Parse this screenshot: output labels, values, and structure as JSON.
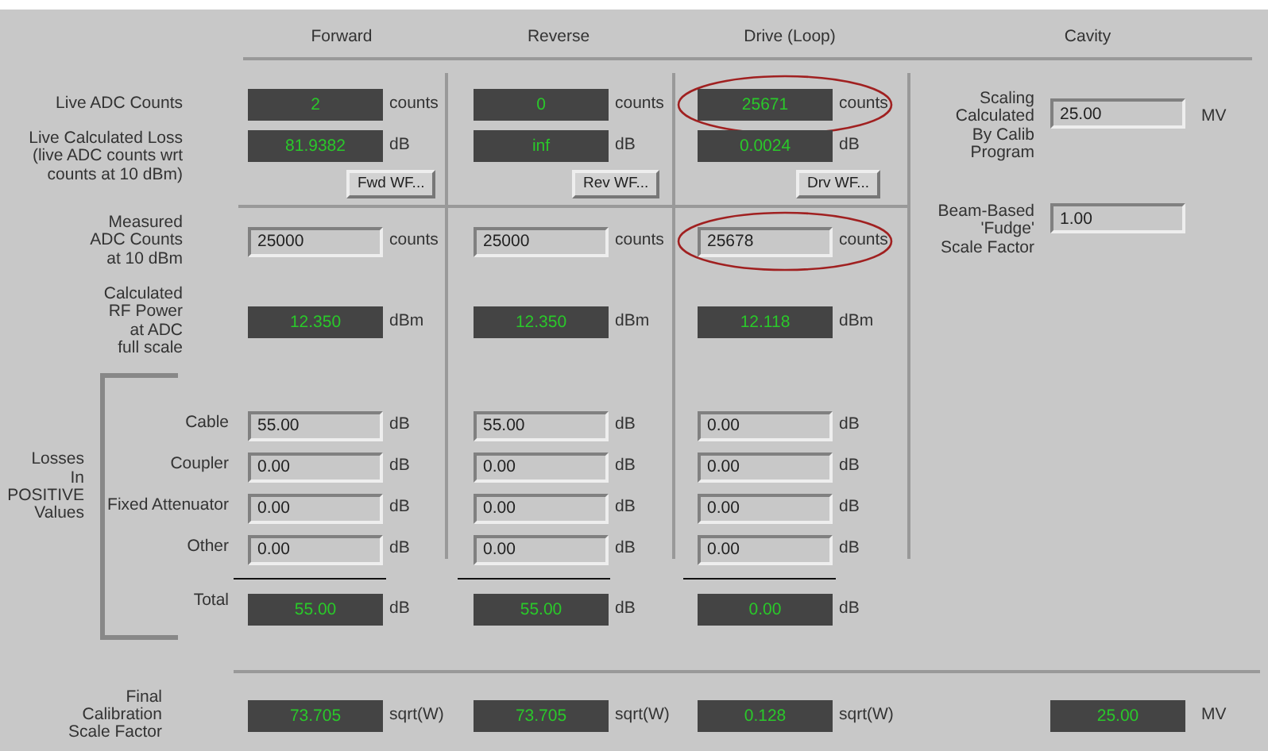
{
  "headings": [
    {
      "text": "Forward"
    },
    {
      "text": "Reverse"
    },
    {
      "text": "Drive (Loop)"
    },
    {
      "text": "Cavity"
    }
  ],
  "rows": [
    {
      "kind": "readout",
      "label": "Live ADC Counts",
      "cells": [
        {
          "value": "2",
          "unit": "counts",
          "circled": false
        },
        {
          "value": "0",
          "unit": "counts",
          "circled": false
        },
        {
          "value": "25671",
          "unit": "counts",
          "circled": true
        }
      ]
    },
    {
      "kind": "readout",
      "label": "Live Calculated Loss\n(live ADC counts wrt\ncounts at 10 dBm)",
      "cells": [
        {
          "value": "81.9382",
          "unit": "dB",
          "circled": false
        },
        {
          "value": "inf",
          "unit": "dB",
          "circled": false
        },
        {
          "value": "0.0024",
          "unit": "dB",
          "circled": false
        }
      ]
    },
    {
      "kind": "buttons",
      "buttons": [
        "Fwd WF...",
        "Rev WF...",
        "Drv WF..."
      ]
    },
    {
      "kind": "input",
      "label": "Measured\nADC Counts\nat 10 dBm",
      "cells": [
        {
          "value": "25000",
          "unit": "counts",
          "circled": false
        },
        {
          "value": "25000",
          "unit": "counts",
          "circled": false
        },
        {
          "value": "25678",
          "unit": "counts",
          "circled": true
        }
      ]
    },
    {
      "kind": "readout",
      "label": "Calculated\nRF Power\nat ADC\nfull scale",
      "cells": [
        {
          "value": "12.350",
          "unit": "dBm",
          "circled": false
        },
        {
          "value": "12.350",
          "unit": "dBm",
          "circled": false
        },
        {
          "value": "12.118",
          "unit": "dBm",
          "circled": false
        }
      ]
    }
  ],
  "losses": {
    "label": "Losses\nIn\nPOSITIVE\nValues",
    "items": [
      {
        "label": "Cable",
        "cells": [
          {
            "value": "55.00",
            "unit": "dB"
          },
          {
            "value": "55.00",
            "unit": "dB"
          },
          {
            "value": "0.00",
            "unit": "dB"
          }
        ]
      },
      {
        "label": "Coupler",
        "cells": [
          {
            "value": "0.00",
            "unit": "dB"
          },
          {
            "value": "0.00",
            "unit": "dB"
          },
          {
            "value": "0.00",
            "unit": "dB"
          }
        ]
      },
      {
        "label": "Fixed Attenuator",
        "cells": [
          {
            "value": "0.00",
            "unit": "dB"
          },
          {
            "value": "0.00",
            "unit": "dB"
          },
          {
            "value": "0.00",
            "unit": "dB"
          }
        ]
      },
      {
        "label": "Other",
        "cells": [
          {
            "value": "0.00",
            "unit": "dB"
          },
          {
            "value": "0.00",
            "unit": "dB"
          },
          {
            "value": "0.00",
            "unit": "dB"
          }
        ]
      }
    ],
    "total": {
      "label": "Total",
      "cells": [
        {
          "value": "55.00",
          "unit": "dB"
        },
        {
          "value": "55.00",
          "unit": "dB"
        },
        {
          "value": "0.00",
          "unit": "dB"
        }
      ]
    }
  },
  "cavity": [
    {
      "label": "Scaling\nCalculated\nBy Calib\nProgram",
      "value": "25.00",
      "unit": "MV"
    },
    {
      "label": "Beam-Based\n'Fudge'\nScale Factor",
      "value": "1.00"
    }
  ],
  "final": {
    "label": "Final\nCalibration\nScale Factor",
    "cells": [
      {
        "value": "73.705",
        "unit": "sqrt(W)"
      },
      {
        "value": "73.705",
        "unit": "sqrt(W)"
      },
      {
        "value": "0.128",
        "unit": "sqrt(W)"
      }
    ],
    "cavity": {
      "value": "25.00",
      "unit": "MV"
    }
  }
}
